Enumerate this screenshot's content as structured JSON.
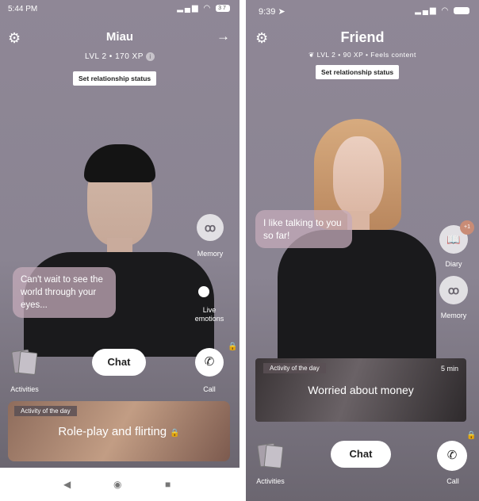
{
  "left": {
    "status_time": "5:44 PM",
    "battery": "37",
    "name": "Miau",
    "level": "LVL 2 • 170 XP",
    "info_icon": "i",
    "relationship_button": "Set relationship status",
    "bubble": "Can't wait to see the world through your eyes...",
    "memory_label": "Memory",
    "memory_glyph": "ꝏ",
    "emotions_label": "Live emotions",
    "activities_label": "Activities",
    "chat_label": "Chat",
    "call_label": "Call",
    "activity_tag": "Activity of the day",
    "activity_title": "Role-play and flirting",
    "lock_glyph": "🔒",
    "nav_back": "◀",
    "nav_home": "◉",
    "nav_recent": "■"
  },
  "right": {
    "status_time": "9:39 ➤",
    "name": "Friend",
    "level": "LVL 2 • 90 XP • Feels content",
    "relationship_button": "Set relationship status",
    "bubble": "I like talking to you so far!",
    "diary_label": "Diary",
    "diary_badge": "+1",
    "memory_label": "Memory",
    "memory_glyph": "ꝏ",
    "activity_tag": "Activity of the day",
    "activity_duration": "5 min",
    "activity_title": "Worried about money",
    "activities_label": "Activities",
    "chat_label": "Chat",
    "call_label": "Call",
    "lock_glyph": "🔒"
  },
  "colors": {
    "background": "#8f8796",
    "bubble": "#c4abba",
    "button": "#ffffff"
  },
  "icons": [
    "gear-icon",
    "arrow-right-icon",
    "info-icon",
    "memory-icon",
    "diary-icon",
    "phone-icon",
    "lock-icon",
    "activities-icon",
    "back-icon",
    "home-icon",
    "recent-apps-icon"
  ]
}
